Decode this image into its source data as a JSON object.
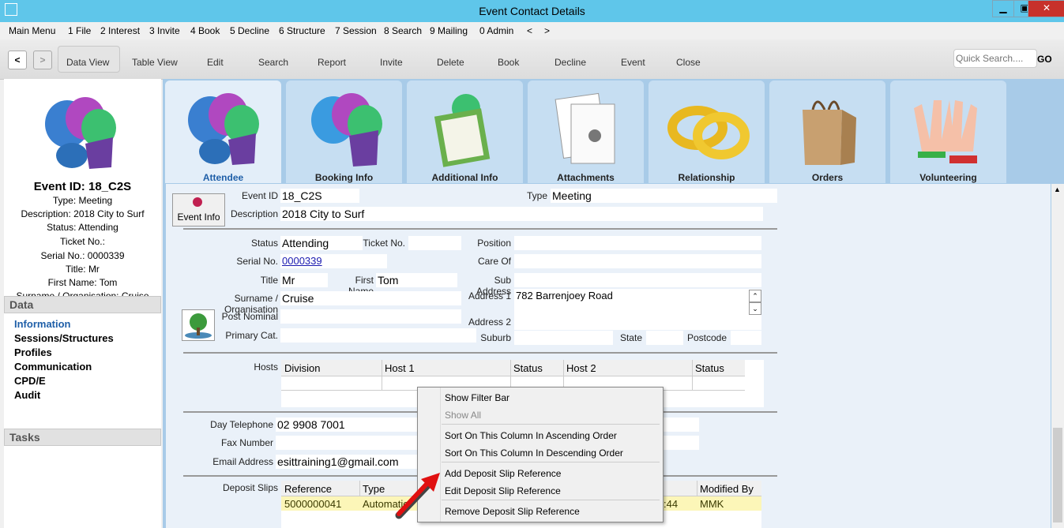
{
  "window": {
    "title": "Event Contact Details"
  },
  "menu": [
    "Main Menu",
    "1 File",
    "2 Interest",
    "3 Invite",
    "4 Book",
    "5 Decline",
    "6 Structure",
    "7 Session",
    "8 Search",
    "9 Mailing",
    "0 Admin",
    "<",
    ">"
  ],
  "toolbar": {
    "back": "<",
    "forward": ">",
    "buttons": [
      "Data View",
      "Table View",
      "Edit",
      "Search",
      "Report",
      "Invite",
      "Delete",
      "Book",
      "Decline",
      "Event",
      "Close"
    ],
    "search_placeholder": "Quick Search....",
    "go": "GO"
  },
  "summary": {
    "event_id": "Event ID: 18_C2S",
    "type": "Type: Meeting",
    "description": "Description: 2018 City to Surf",
    "status": "Status: Attending",
    "ticket": "Ticket No.:",
    "serial": "Serial No.: 0000339",
    "title": "Title: Mr",
    "first_name": "First Name: Tom",
    "surname": "Surname / Organisation: Cruise"
  },
  "left_nav": {
    "data_header": "Data",
    "items": [
      "Information",
      "Sessions/Structures",
      "Profiles",
      "Communication",
      "CPD/E",
      "Audit"
    ],
    "tasks_header": "Tasks"
  },
  "tabs": [
    "Attendee",
    "Booking Info",
    "Additional Info",
    "Attachments",
    "Relationship",
    "Orders",
    "Volunteering"
  ],
  "form": {
    "event_info_button": "Event Info",
    "labels": {
      "event_id": "Event ID",
      "type": "Type",
      "description": "Description",
      "status": "Status",
      "ticket_no": "Ticket No.",
      "position": "Position",
      "serial_no": "Serial No.",
      "care_of": "Care Of",
      "title": "Title",
      "first_name": "First Name",
      "sub_address": "Sub Address",
      "surname": "Surname / Organisation",
      "address1": "Address 1",
      "post_nominal": "Post Nominal",
      "address2": "Address 2",
      "primary_cat": "Primary Cat.",
      "suburb": "Suburb",
      "state": "State",
      "postcode": "Postcode",
      "hosts": "Hosts",
      "day_telephone": "Day Telephone",
      "fax": "Fax Number",
      "email": "Email Address",
      "deposit_slips": "Deposit Slips"
    },
    "values": {
      "event_id": "18_C2S",
      "type": "Meeting",
      "description": "2018 City to Surf",
      "status": "Attending",
      "serial_no": "0000339",
      "title": "Mr",
      "first_name": "Tom",
      "surname": "Cruise",
      "address1": "782 Barrenjoey Road",
      "day_telephone": "02 9908 7001",
      "email": "esittraining1@gmail.com"
    },
    "hosts_table": {
      "columns": [
        "Division",
        "Host 1",
        "Status",
        "Host 2",
        "Status"
      ]
    },
    "deposit_table": {
      "columns": [
        "Reference",
        "Type",
        "Modified By"
      ],
      "row": {
        "reference": "5000000041",
        "type": "Automatic",
        "time": ":44",
        "modified_by": "MMK"
      }
    }
  },
  "context_menu": {
    "items": [
      "Show Filter Bar",
      "Show All",
      "Sort On This Column In Ascending Order",
      "Sort On This Column In Descending Order",
      "Add Deposit Slip Reference",
      "Edit Deposit Slip Reference",
      "Remove Deposit Slip Reference"
    ]
  }
}
